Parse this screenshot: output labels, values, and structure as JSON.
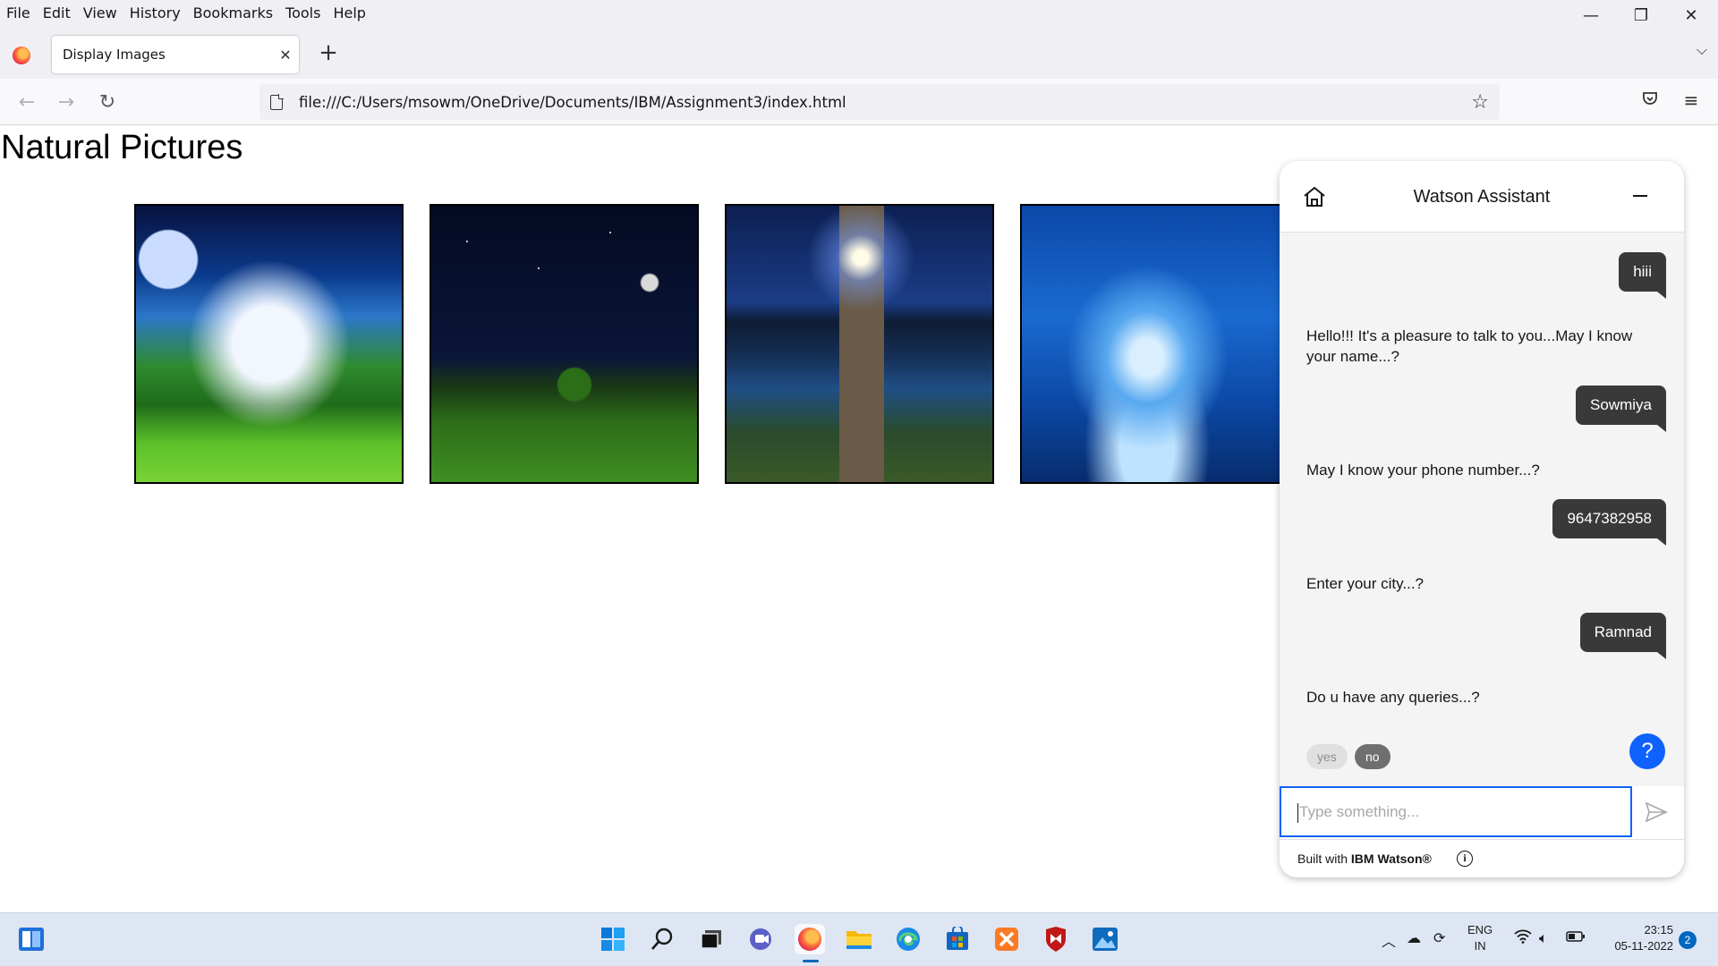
{
  "browser": {
    "menu": [
      "File",
      "Edit",
      "View",
      "History",
      "Bookmarks",
      "Tools",
      "Help"
    ],
    "tab_title": "Display Images",
    "url": "file:///C:/Users/msowm/OneDrive/Documents/IBM/Assignment3/index.html"
  },
  "page": {
    "title": "Natural Pictures",
    "images": [
      "fantasy-landscape-image",
      "night-sky-tree-image",
      "lake-pier-moon-image",
      "water-splash-image"
    ]
  },
  "watson": {
    "title": "Watson Assistant",
    "messages": [
      {
        "from": "user",
        "text": "hiii"
      },
      {
        "from": "bot",
        "text": "Hello!!! It's a pleasure to talk to you...May I know your name...?"
      },
      {
        "from": "user",
        "text": "Sowmiya"
      },
      {
        "from": "bot",
        "text": "May I know your phone number...?"
      },
      {
        "from": "user",
        "text": "9647382958"
      },
      {
        "from": "bot",
        "text": "Enter your city...?"
      },
      {
        "from": "user",
        "text": "Ramnad"
      },
      {
        "from": "bot",
        "text": "Do u have any queries...?"
      }
    ],
    "options": [
      "yes",
      "no"
    ],
    "selected_option": "no",
    "help_label": "?",
    "input_placeholder": "Type something...",
    "footer_prefix": "Built with ",
    "footer_brand": "IBM Watson®",
    "accent_color": "#0f62fe"
  },
  "taskbar": {
    "apps": [
      "start-icon",
      "search-icon",
      "task-view-icon",
      "teams-chat-icon",
      "firefox-icon",
      "file-explorer-icon",
      "edge-icon",
      "store-icon",
      "xampp-icon",
      "mcafee-icon",
      "photos-icon"
    ],
    "language": "ENG",
    "region": "IN",
    "time": "23:15",
    "date": "05-11-2022",
    "notifications": "2"
  }
}
